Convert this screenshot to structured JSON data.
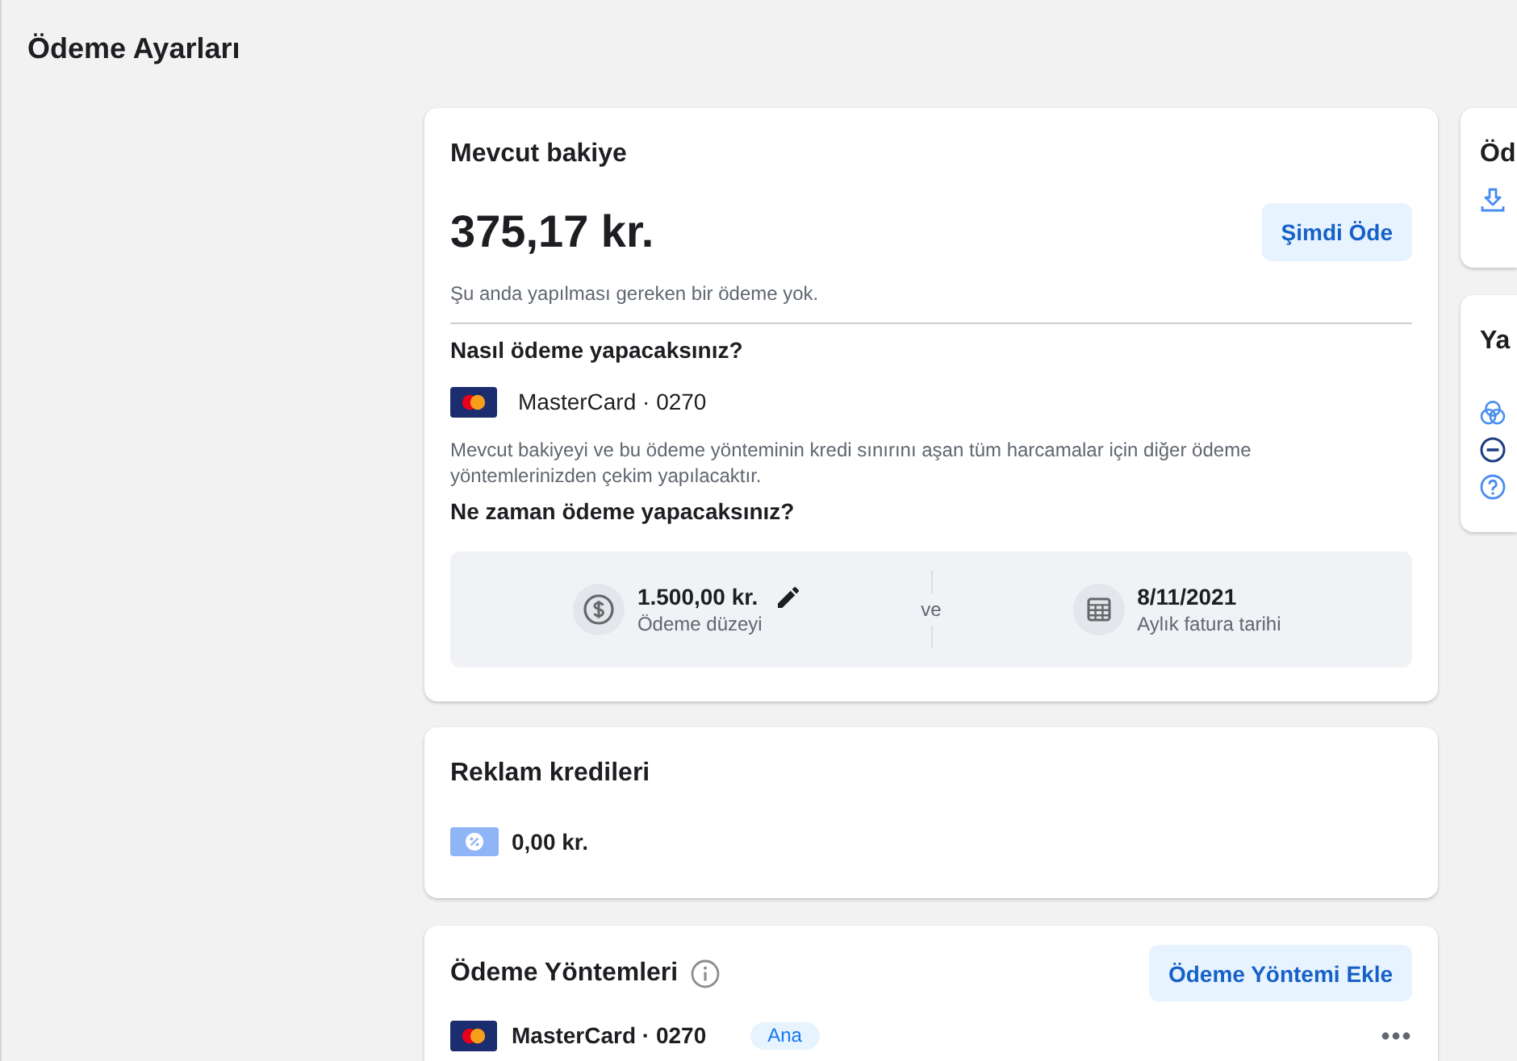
{
  "page": {
    "title": "Ödeme Ayarları"
  },
  "balance": {
    "title": "Mevcut bakiye",
    "amount": "375,17 kr.",
    "pay_button": "Şimdi Öde",
    "note": "Şu anda yapılması gereken bir ödeme yok.",
    "how_heading": "Nasıl ödeme yapacaksınız?",
    "method": "MasterCard · 0270",
    "method_note": "Mevcut bakiyeyi ve bu ödeme yönteminin kredi sınırını aşan tüm harcamalar için diğer ödeme yöntemlerinizden çekim yapılacaktır.",
    "when_heading": "Ne zaman ödeme yapacaksınız?",
    "schedule": {
      "items": [
        {
          "kind": "threshold",
          "value": "1.500,00 kr.",
          "label": "Ödeme düzeyi"
        },
        {
          "kind": "date",
          "value": "8/11/2021",
          "label": "Aylık fatura tarihi"
        }
      ],
      "joiner": "ve"
    }
  },
  "ad_credits": {
    "title": "Reklam kredileri",
    "amount": "0,00 kr."
  },
  "payment_methods": {
    "title": "Ödeme Yöntemleri",
    "add_button": "Ödeme Yöntemi Ekle",
    "items": [
      {
        "name": "MasterCard · 0270",
        "badge": "Ana"
      }
    ]
  },
  "side_cards": [
    {
      "title": "Öd",
      "links": [
        {
          "kind": "download"
        }
      ]
    },
    {
      "title": "Ya",
      "links": [
        {
          "kind": "accounts"
        },
        {
          "kind": "remove"
        },
        {
          "kind": "help"
        }
      ]
    }
  ]
}
